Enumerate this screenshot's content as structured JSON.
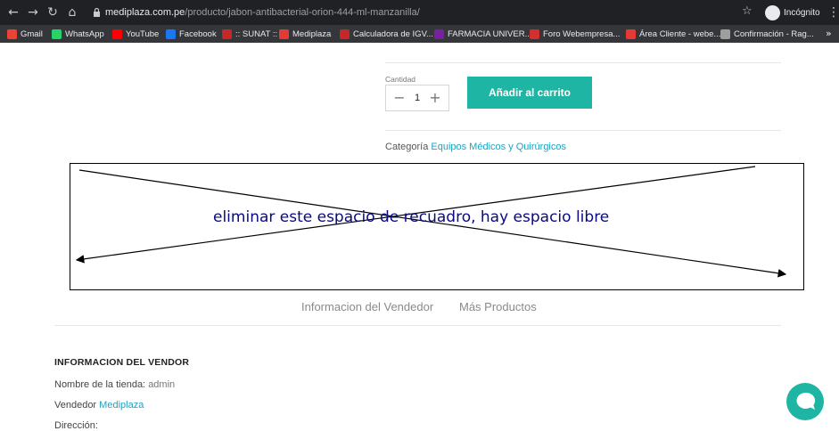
{
  "browser": {
    "url_host": "mediplaza.com.pe",
    "url_path": "/producto/jabon-antibacterial-orion-444-ml-manzanilla/",
    "incognito_label": "Incógnito",
    "bookmarks": [
      {
        "label": "Gmail",
        "color": "#ea4335"
      },
      {
        "label": "WhatsApp",
        "color": "#25d366"
      },
      {
        "label": "YouTube",
        "color": "#ff0000"
      },
      {
        "label": "Facebook",
        "color": "#1877f2"
      },
      {
        "label": ":: SUNAT ::",
        "color": "#c62828"
      },
      {
        "label": "Mediplaza",
        "color": "#e53935"
      },
      {
        "label": "Calculadora de IGV...",
        "color": "#c62828"
      },
      {
        "label": "FARMACIA UNIVER...",
        "color": "#7b1fa2"
      },
      {
        "label": "Foro Webempresa...",
        "color": "#d32f2f"
      },
      {
        "label": "Área Cliente - webe...",
        "color": "#e53935"
      },
      {
        "label": "Confirmación - Rag...",
        "color": "#9e9e9e"
      }
    ],
    "more_label": "»"
  },
  "product": {
    "qty_label": "Cantidad",
    "qty_value": "1",
    "add_to_cart_label": "Añadir al carrito",
    "category_prefix": "Categoría",
    "category_link": "Equipos Médicos y Quirúrgicos"
  },
  "annotation": {
    "text": "eliminar este espacio de recuadro, hay espacio libre"
  },
  "tabs": [
    {
      "label": "Informacion del Vendedor"
    },
    {
      "label": "Más Productos"
    }
  ],
  "vendor": {
    "title": "INFORMACION DEL VENDOR",
    "store_name_label": "Nombre de la tienda:",
    "store_name_value": "admin",
    "vendor_label": "Vendedor",
    "vendor_link": "Mediplaza",
    "address_label": "Dirección:"
  },
  "colors": {
    "accent": "#1fb5a4",
    "link": "#1fa3c1",
    "annotation_text": "#0a0a80"
  }
}
